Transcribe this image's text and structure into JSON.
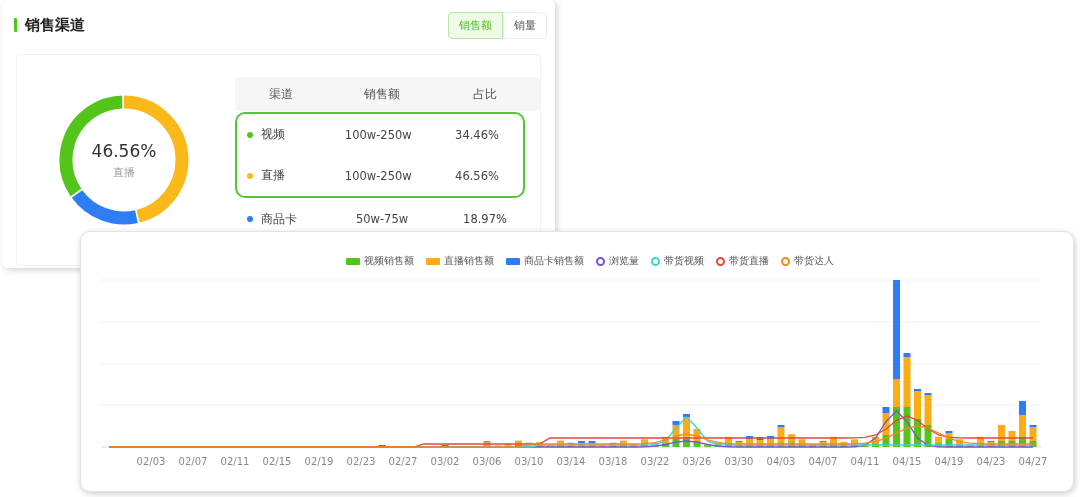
{
  "channel_card": {
    "title": "销售渠道",
    "toggle": [
      {
        "label": "销售额",
        "selected": true
      },
      {
        "label": "销量",
        "selected": false
      }
    ],
    "donut": {
      "center_value": "46.56%",
      "center_label": "直播"
    },
    "table": {
      "columns": [
        "渠道",
        "销售额",
        "占比"
      ],
      "rows": [
        {
          "channel": "视频",
          "sales": "100w-250w",
          "share": "34.46%",
          "color": "#52c41a",
          "highlighted": true
        },
        {
          "channel": "直播",
          "sales": "100w-250w",
          "share": "46.56%",
          "color": "#fbb81b",
          "highlighted": true
        },
        {
          "channel": "商品卡",
          "sales": "50w-75w",
          "share": "18.97%",
          "color": "#2f7df6",
          "highlighted": false
        }
      ]
    }
  },
  "trend_card": {
    "legend": [
      {
        "label": "视频销售额",
        "kind": "bar",
        "color": "#52c41a"
      },
      {
        "label": "直播销售额",
        "kind": "bar",
        "color": "#faad14"
      },
      {
        "label": "商品卡销售额",
        "kind": "bar",
        "color": "#2f7df6"
      },
      {
        "label": "浏览量",
        "kind": "line",
        "color": "#7b4fd6"
      },
      {
        "label": "带货视频",
        "kind": "line",
        "color": "#3fd0d8"
      },
      {
        "label": "带货直播",
        "kind": "line",
        "color": "#e0483f"
      },
      {
        "label": "带货达人",
        "kind": "line",
        "color": "#f08a24"
      }
    ],
    "x_labels": [
      "02/03",
      "02/07",
      "02/11",
      "02/15",
      "02/19",
      "02/23",
      "02/27",
      "03/02",
      "03/06",
      "03/10",
      "03/14",
      "03/18",
      "03/22",
      "03/26",
      "03/30",
      "04/03",
      "04/07",
      "04/11",
      "04/15",
      "04/19",
      "04/23",
      "04/27"
    ]
  }
}
